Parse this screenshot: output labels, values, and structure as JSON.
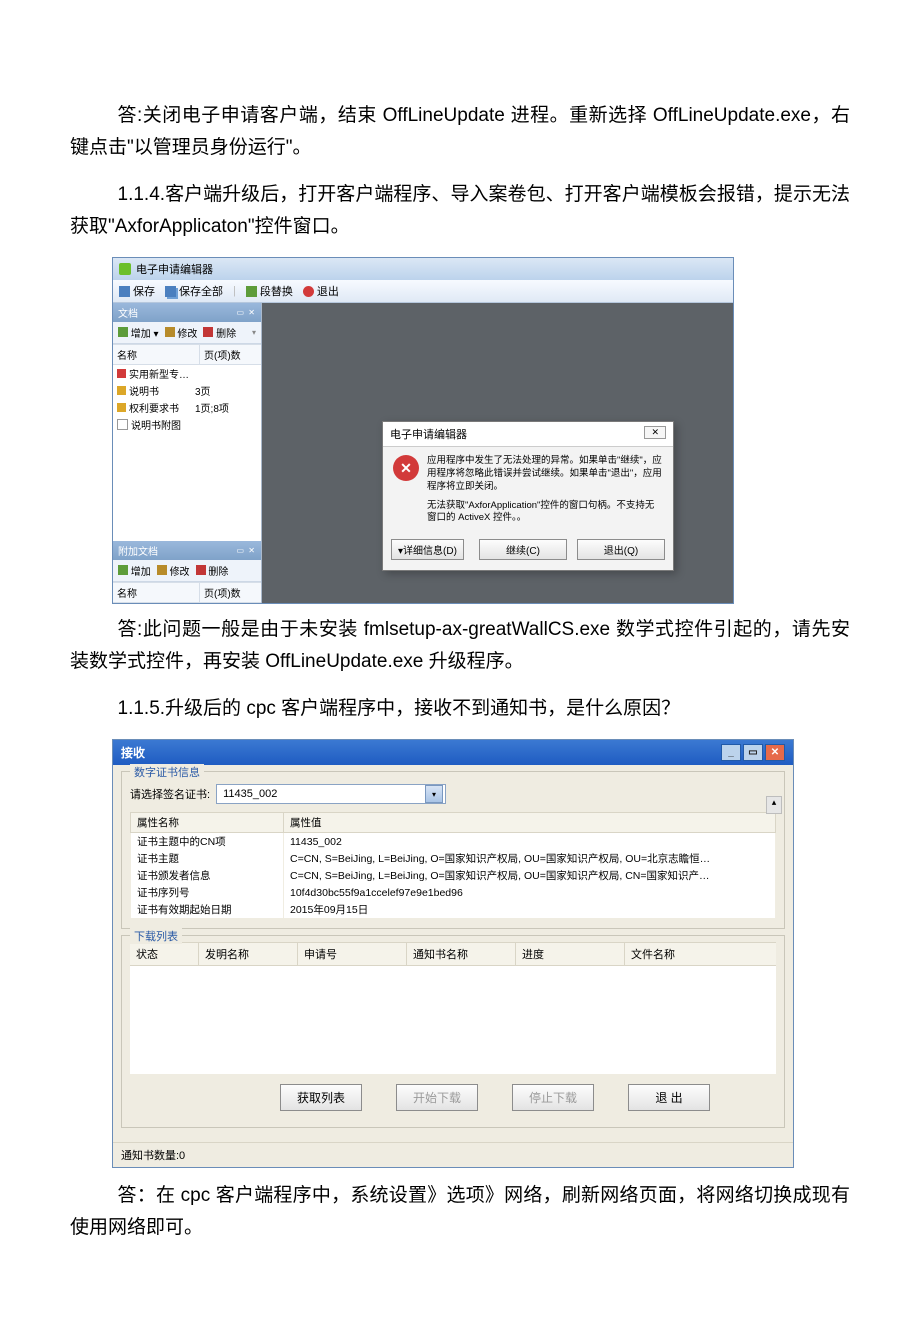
{
  "para1": "答:关闭电子申请客户端，结束 OffLineUpdate 进程。重新选择 OffLineUpdate.exe，右键点击\"以管理员身份运行\"。",
  "para2": "1.1.4.客户端升级后，打开客户端程序、导入案卷包、打开客户端模板会报错，提示无法获取\"AxforApplicaton\"控件窗口。",
  "para3": "答:此问题一般是由于未安装 fmlsetup-ax-greatWallCS.exe 数学式控件引起的，请先安装数学式控件，再安装 OffLineUpdate.exe 升级程序。",
  "para4": "1.1.5.升级后的 cpc 客户端程序中，接收不到通知书，是什么原因？",
  "para5": "答：在 cpc 客户端程序中，系统设置》选项》网络，刷新网络页面，将网络切换成现有使用网络即可。",
  "shot1": {
    "title": "电子申请编辑器",
    "toolbar": {
      "save": "保存",
      "saveAll": "保存全部",
      "replace": "段替换",
      "exit": "退出"
    },
    "panes": {
      "docs": {
        "title": "文档",
        "add": "增加",
        "edit": "修改",
        "del": "删除",
        "colName": "名称",
        "colPages": "页(项)数",
        "items": [
          {
            "name": "实用新型专…",
            "pages": ""
          },
          {
            "name": "说明书",
            "pages": "3页"
          },
          {
            "name": "权利要求书",
            "pages": "1页;8项"
          },
          {
            "name": "说明书附图",
            "pages": ""
          }
        ]
      },
      "attach": {
        "title": "附加文档",
        "add": "增加",
        "edit": "修改",
        "del": "删除",
        "colName": "名称",
        "colPages": "页(项)数"
      }
    },
    "dialog": {
      "title": "电子申请编辑器",
      "line1": "应用程序中发生了无法处理的异常。如果单击\"继续\"，应用程序将忽略此错误并尝试继续。如果单击\"退出\"，应用程序将立即关闭。",
      "line2": "无法获取\"AxforApplication\"控件的窗口句柄。不支持无窗口的 ActiveX 控件。。",
      "details": "▾详细信息(D)",
      "continue": "继续(C)",
      "quit": "退出(Q)"
    }
  },
  "shot2": {
    "title": "接收",
    "cert": {
      "legend": "数字证书信息",
      "label": "请选择签名证书:",
      "value": "11435_002",
      "colName": "属性名称",
      "colVal": "属性值",
      "rows": [
        {
          "n": "证书主题中的CN项",
          "v": "11435_002"
        },
        {
          "n": "证书主题",
          "v": "C=CN, S=BeiJing, L=BeiJing, O=国家知识产权局, OU=国家知识产权局, OU=北京志瞻恒…"
        },
        {
          "n": "证书颁发者信息",
          "v": "C=CN, S=BeiJing, L=BeiJing, O=国家知识产权局, OU=国家知识产权局, CN=国家知识产…"
        },
        {
          "n": "证书序列号",
          "v": "10f4d30bc55f9a1ccelef97e9e1bed96"
        },
        {
          "n": "证书有效期起始日期",
          "v": "2015年09月15日"
        }
      ]
    },
    "dl": {
      "legend": "下载列表",
      "cols": {
        "status": "状态",
        "invname": "发明名称",
        "appno": "申请号",
        "notice": "通知书名称",
        "progress": "进度",
        "file": "文件名称"
      }
    },
    "btns": {
      "fetch": "获取列表",
      "start": "开始下载",
      "stop": "停止下载",
      "exit": "退 出"
    },
    "status": "通知书数量:0"
  }
}
